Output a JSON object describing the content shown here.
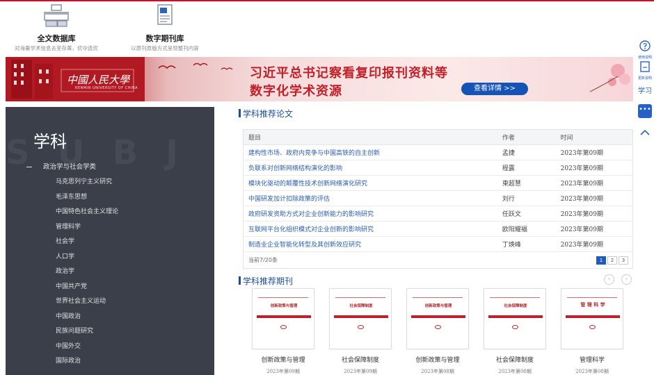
{
  "databases": [
    {
      "title": "全文数据库",
      "desc": "对海量学术信息去芜存菁，优中选优",
      "icon": "bookshelf-icon"
    },
    {
      "title": "数字期刊库",
      "desc": "以原刊原版方式呈现整刊内容",
      "icon": "journal-icon"
    }
  ],
  "banner": {
    "logo": "中國人民大學",
    "logo_sub": "RENMIN UNIVERSITY OF CHINA",
    "line1": "习近平总书记察看复印报刊资料等",
    "line2": "数字化学术资源",
    "button": "查看详情 >>"
  },
  "side_widgets": {
    "help_label": "使用说明",
    "update_label": "更新说明",
    "tag": "学习"
  },
  "subject": {
    "bg_text": "SUBJ",
    "title": "学科",
    "parent": "政治学与社会学类",
    "items": [
      "马克思列宁主义研究",
      "毛泽东思想",
      "中国特色社会主义理论",
      "管理科学",
      "社会学",
      "人口学",
      "政治学",
      "中国共产党",
      "世界社会主义运动",
      "中国政治",
      "民族问题研究",
      "中国外交",
      "国际政治"
    ]
  },
  "papers": {
    "section_title": "学科推荐论文",
    "headers": {
      "title": "题目",
      "author": "作者",
      "date": "时间"
    },
    "rows": [
      {
        "title": "建构性市场、政府内竞争与中国高铁的自主创新",
        "author": "孟捷",
        "date": "2023年第09期"
      },
      {
        "title": "负联系对创新网络结构演化的影响",
        "author": "程露",
        "date": "2023年第09期"
      },
      {
        "title": "模块化驱动的颠覆性技术创新网络演化研究",
        "author": "東超慧",
        "date": "2023年第09期"
      },
      {
        "title": "中国研发加计扣除政策的评估",
        "author": "刘行",
        "date": "2023年第09期"
      },
      {
        "title": "政府研发资助方式对企业创新能力的影响研究",
        "author": "任跃文",
        "date": "2023年第09期"
      },
      {
        "title": "互联网平台化组织模式对企业创新的影响研究",
        "author": "欧阳耀福",
        "date": "2023年第09期"
      },
      {
        "title": "制造业企业智能化转型及其创新效应研究",
        "author": "丁焕峰",
        "date": "2023年第09期"
      }
    ],
    "footer": "当前7/20条",
    "pages": [
      "1",
      "2",
      "3"
    ],
    "current_page": "1"
  },
  "journals": {
    "section_title": "学科推荐期刊",
    "items": [
      {
        "name": "创新政策与管理",
        "cover": "创新政策与管理",
        "issue": "2023年第09期"
      },
      {
        "name": "社会保障制度",
        "cover": "社会保障制度",
        "issue": "2023年第09期"
      },
      {
        "name": "创新政策与管理",
        "cover": "创新政策与管理",
        "issue": "2023年第08期"
      },
      {
        "name": "社会保障制度",
        "cover": "社会保障制度",
        "issue": "2023年第08期"
      },
      {
        "name": "管理科学",
        "cover": "管 理 科 学",
        "issue": "2023年第08期"
      }
    ]
  },
  "colors": {
    "accent_red": "#c8102e",
    "link_blue": "#2a5db0",
    "panel_bg": "#3a3f4a",
    "button_blue": "#1553b8"
  }
}
